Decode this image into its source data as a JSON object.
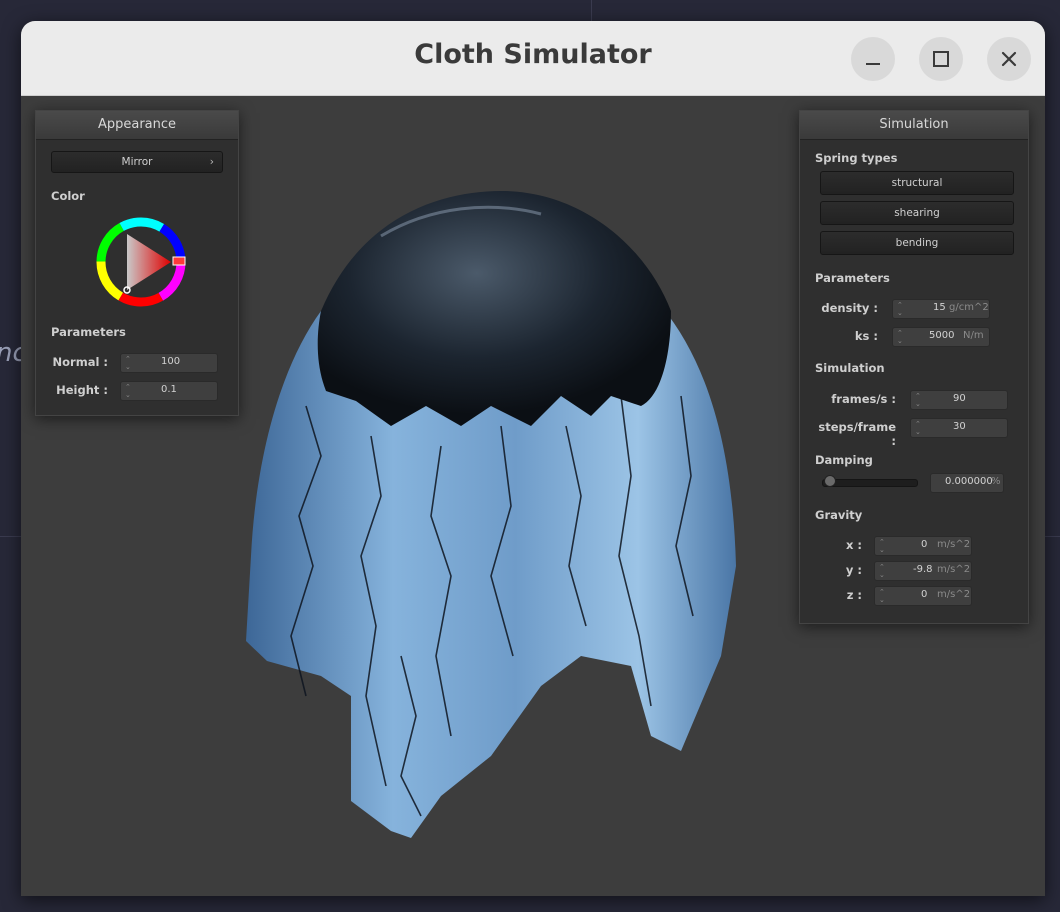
{
  "window": {
    "title": "Cloth Simulator"
  },
  "background": {
    "partial_text": "nc"
  },
  "appearance": {
    "header": "Appearance",
    "shader_select": "Mirror",
    "color_label": "Color",
    "params_label": "Parameters",
    "normal_label": "Normal :",
    "normal_value": "100",
    "height_label": "Height :",
    "height_value": "0.1"
  },
  "simulation": {
    "header": "Simulation",
    "spring_types_label": "Spring types",
    "spring_buttons": [
      "structural",
      "shearing",
      "bending"
    ],
    "params_label": "Parameters",
    "density_label": "density :",
    "density_value": "15",
    "density_unit": "g/cm^2",
    "ks_label": "ks :",
    "ks_value": "5000",
    "ks_unit": "N/m",
    "sim_label": "Simulation",
    "fps_label": "frames/s :",
    "fps_value": "90",
    "steps_label": "steps/frame :",
    "steps_value": "30",
    "damping_label": "Damping",
    "damping_value": "0.000000",
    "damping_unit": "%",
    "damping_level": 0,
    "gravity_label": "Gravity",
    "gx_label": "x :",
    "gx_value": "0",
    "gy_label": "y :",
    "gy_value": "-9.8",
    "gz_label": "z :",
    "gz_value": "0",
    "g_unit": "m/s^2"
  }
}
